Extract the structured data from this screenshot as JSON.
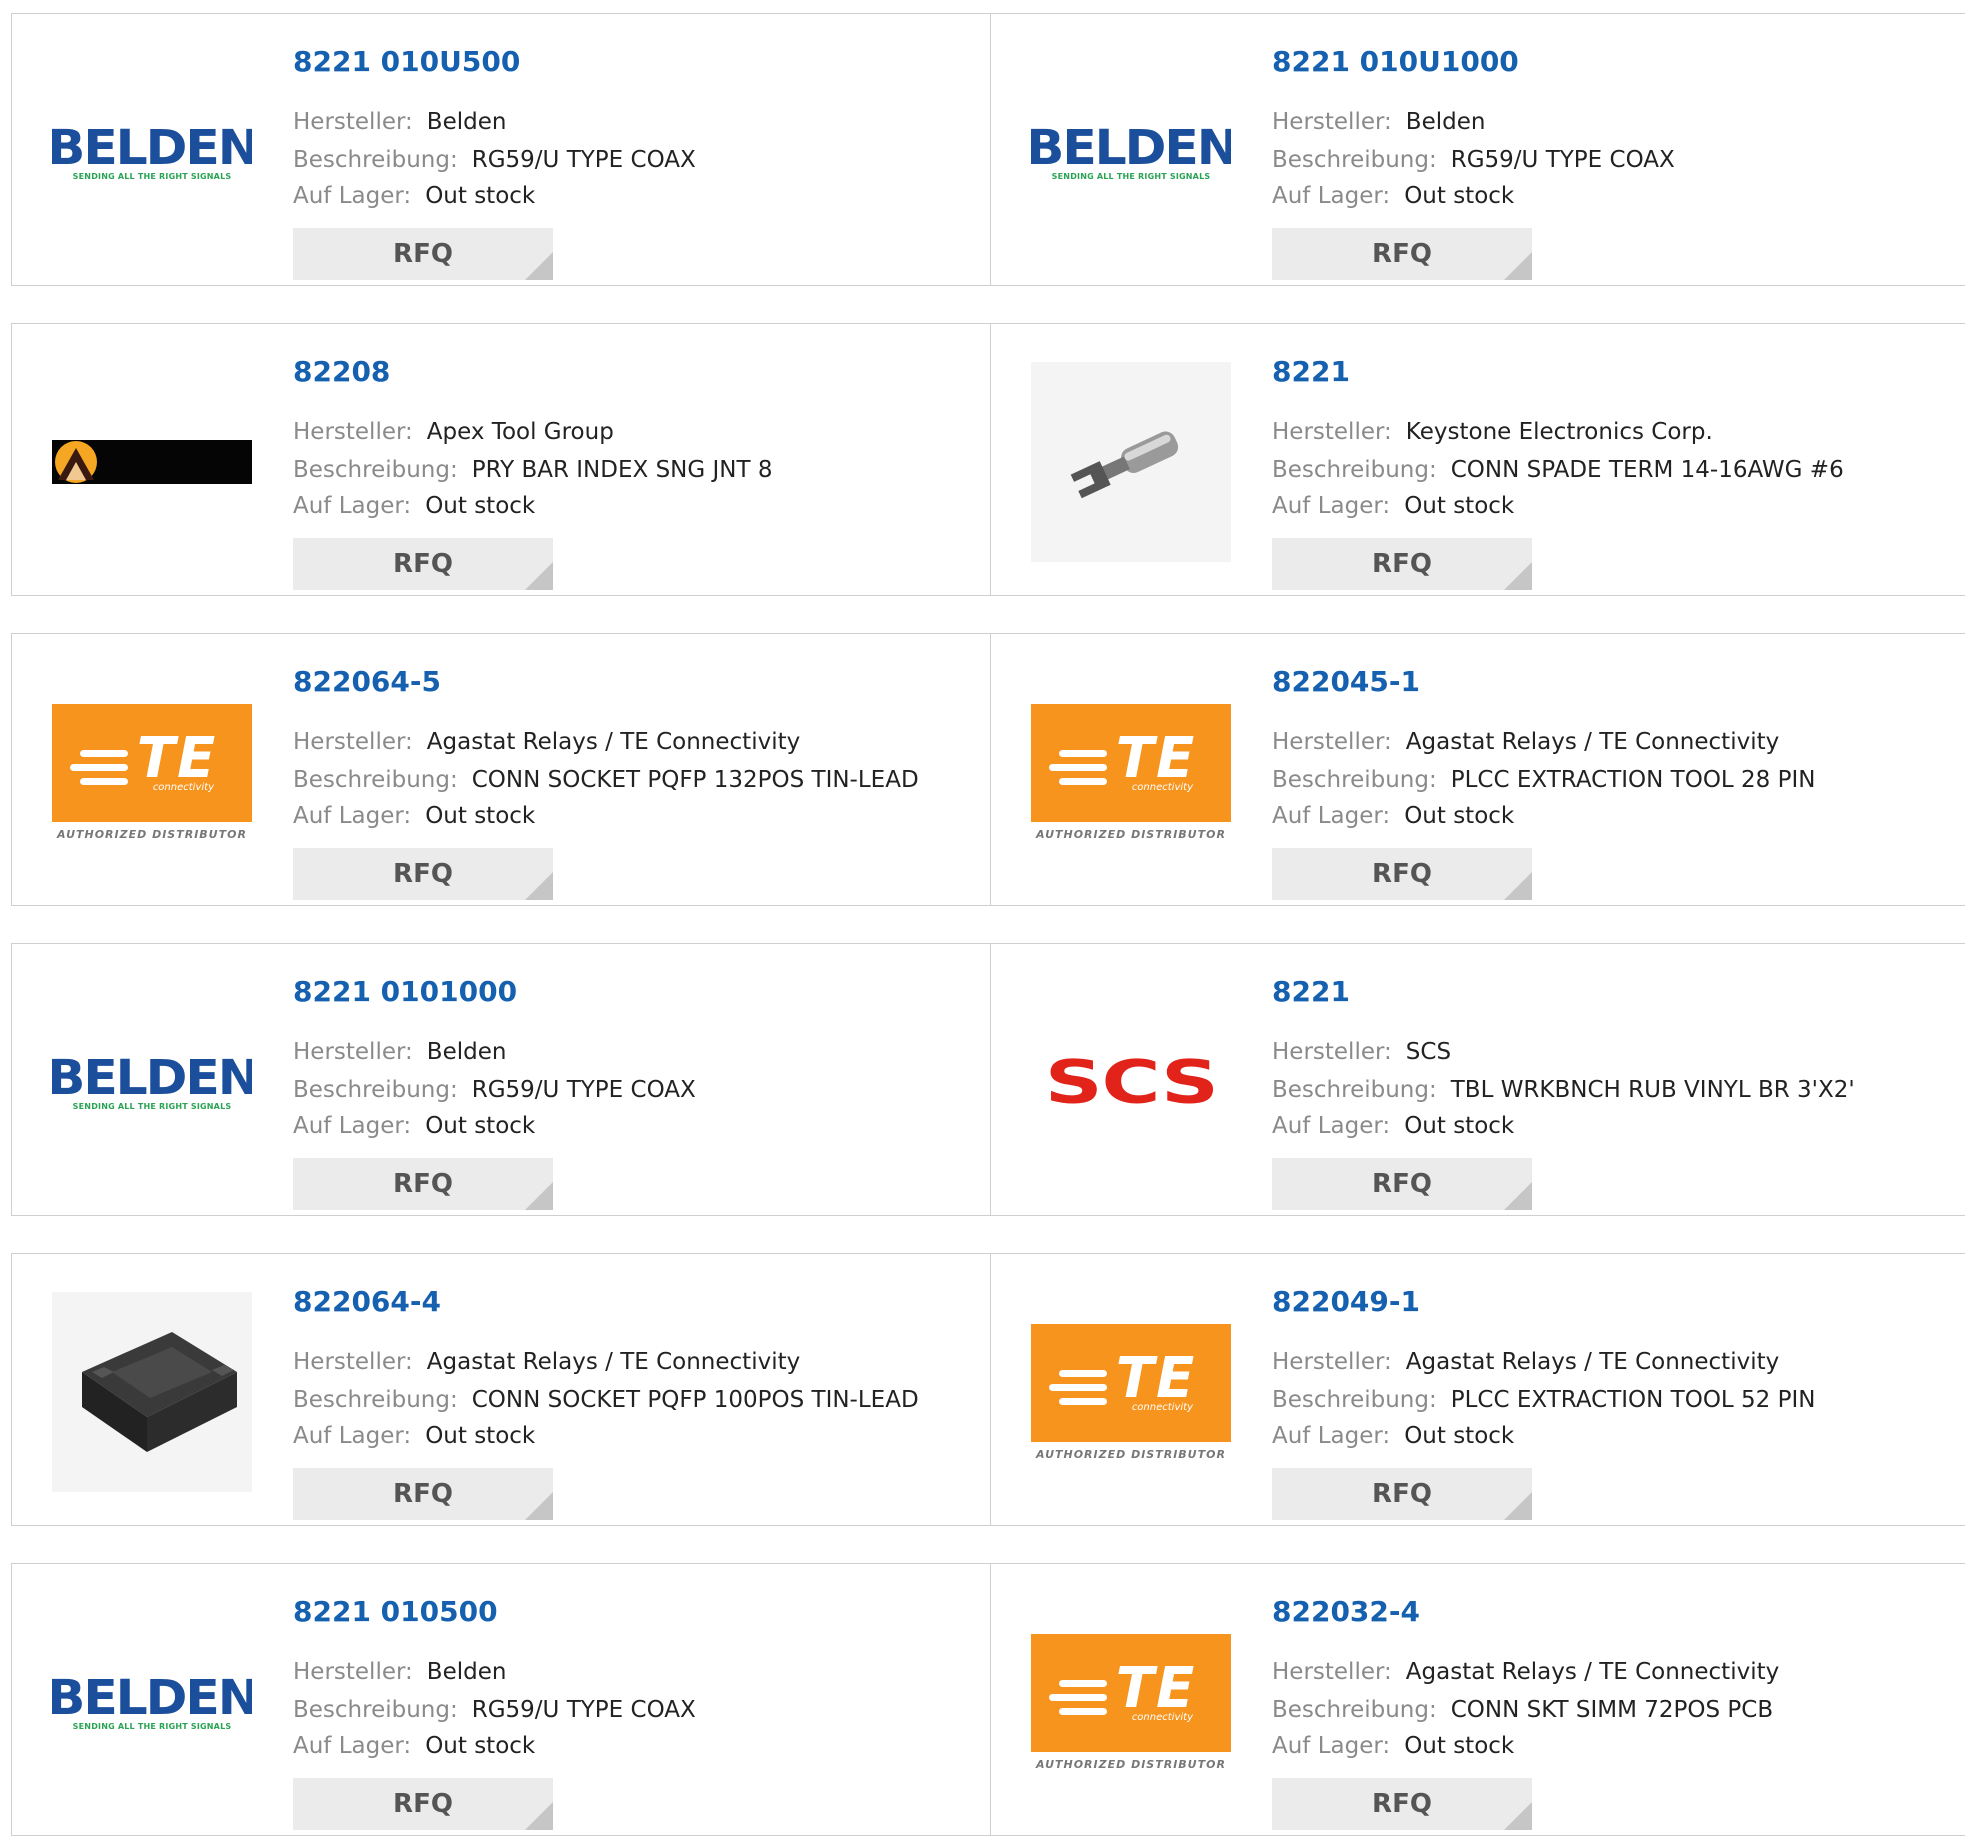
{
  "labels": {
    "manufacturer": "Hersteller:",
    "description": "Beschreibung:",
    "stock": "Auf Lager:",
    "rfq": "RFQ"
  },
  "colors": {
    "part_link": "#1660b0",
    "te_orange": "#f7941d",
    "scs_red": "#e2231a",
    "belden_blue": "#1b4f9c",
    "belden_green": "#2aa354"
  },
  "rows": [
    {
      "cards": [
        {
          "part": "8221 010U500",
          "manufacturer": "Belden",
          "description": "RG59/U TYPE COAX",
          "stock": "Out stock",
          "logo": "belden-logo"
        },
        {
          "part": "8221 010U1000",
          "manufacturer": "Belden",
          "description": "RG59/U TYPE COAX",
          "stock": "Out stock",
          "logo": "belden-logo"
        }
      ]
    },
    {
      "cards": [
        {
          "part": "82208",
          "manufacturer": "Apex Tool Group",
          "description": "PRY BAR INDEX SNG JNT 8",
          "stock": "Out stock",
          "logo": "apex-logo"
        },
        {
          "part": "8221",
          "manufacturer": "Keystone Electronics Corp.",
          "description": "CONN SPADE TERM 14-16AWG #6",
          "stock": "Out stock",
          "logo": "spade-terminal-image"
        }
      ]
    },
    {
      "cards": [
        {
          "part": "822064-5",
          "manufacturer": "Agastat Relays / TE Connectivity",
          "description": "CONN SOCKET PQFP 132POS TIN-LEAD",
          "stock": "Out stock",
          "logo": "te-logo"
        },
        {
          "part": "822045-1",
          "manufacturer": "Agastat Relays / TE Connectivity",
          "description": "PLCC EXTRACTION TOOL 28 PIN",
          "stock": "Out stock",
          "logo": "te-logo"
        }
      ]
    },
    {
      "cards": [
        {
          "part": "8221 0101000",
          "manufacturer": "Belden",
          "description": "RG59/U TYPE COAX",
          "stock": "Out stock",
          "logo": "belden-logo"
        },
        {
          "part": "8221",
          "manufacturer": "SCS",
          "description": "TBL WRKBNCH RUB VINYL BR 3'X2'",
          "stock": "Out stock",
          "logo": "scs-logo"
        }
      ]
    },
    {
      "cards": [
        {
          "part": "822064-4",
          "manufacturer": "Agastat Relays / TE Connectivity",
          "description": "CONN SOCKET PQFP 100POS TIN-LEAD",
          "stock": "Out stock",
          "logo": "socket-image"
        },
        {
          "part": "822049-1",
          "manufacturer": "Agastat Relays / TE Connectivity",
          "description": "PLCC EXTRACTION TOOL 52 PIN",
          "stock": "Out stock",
          "logo": "te-logo"
        }
      ]
    },
    {
      "cards": [
        {
          "part": "8221 010500",
          "manufacturer": "Belden",
          "description": "RG59/U TYPE COAX",
          "stock": "Out stock",
          "logo": "belden-logo"
        },
        {
          "part": "822032-4",
          "manufacturer": "Agastat Relays / TE Connectivity",
          "description": "CONN SKT SIMM 72POS PCB",
          "stock": "Out stock",
          "logo": "te-logo"
        }
      ]
    }
  ],
  "logo_text": {
    "belden_word": "BELDEN",
    "belden_tag": "SENDING ALL THE RIGHT SIGNALS",
    "te_word": "TE",
    "te_sub": "connectivity",
    "te_authorized": "AUTHORIZED DISTRIBUTOR",
    "scs_word": "SCS"
  }
}
